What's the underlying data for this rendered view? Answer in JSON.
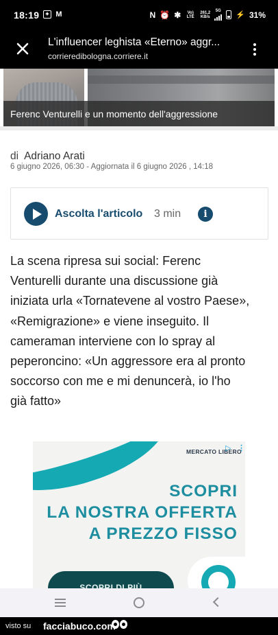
{
  "status_bar": {
    "time": "18:19",
    "network_speed": "261,2",
    "network_speed_unit": "KB/s",
    "network_label": "Vo) LTE",
    "network_type": "5G",
    "battery": "31%"
  },
  "custom_tab": {
    "title": "L'influencer leghista «Eterno» aggr...",
    "domain": "corrieredibologna.corriere.it"
  },
  "hero": {
    "caption": "Ferenc Venturelli e un momento dell'aggressione"
  },
  "article": {
    "author_prefix": "di",
    "author": "Adriano Arati",
    "dates": "6 giugno 2026, 06:30 - Aggiornata il 6 giugno 2026 , 14:18",
    "listen_label": "Ascolta l'articolo",
    "listen_duration": "3 min",
    "info_symbol": "i",
    "lead_lines": [
      "La scena ripresa sui social: Ferenc",
      "Venturelli durante una discussione già",
      "iniziata urla «Tornatevene al vostro Paese»,",
      "«Remigrazione» e viene inseguito. Il",
      "cameraman interviene con lo spray al",
      "peperoncino: «Un aggressore era al pronto",
      "soccorso con me e mi denuncerà, io l'ho",
      "già fatto»"
    ]
  },
  "ad": {
    "brand": "MERCATO LIBERO",
    "line1": "SCOPRI",
    "line2": "LA NOSTRA OFFERTA",
    "line3": "A PREZZO FISSO",
    "cta": "SCOPRI DI PIÙ",
    "adchoices_symbol": "▷",
    "kebab": "⋮",
    "accent_color": "#14a9b3"
  },
  "footer": {
    "prefix": "visto su",
    "site": "facciabuco.com"
  },
  "colors": {
    "accent": "#174c6f",
    "topbar": "#000000"
  }
}
